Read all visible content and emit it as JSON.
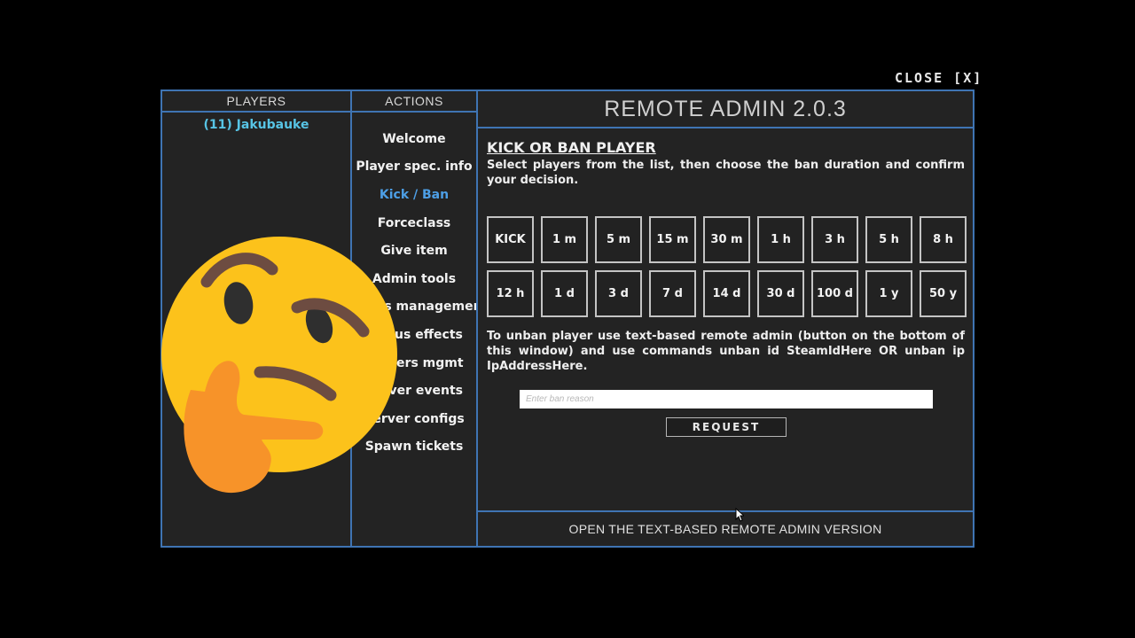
{
  "close_label": "CLOSE [X]",
  "players": {
    "header": "PLAYERS",
    "items": [
      {
        "label": "(11) Jakubauke"
      }
    ]
  },
  "actions": {
    "header": "ACTIONS",
    "items": [
      {
        "label": "Welcome",
        "active": false
      },
      {
        "label": "Player spec. info",
        "active": false
      },
      {
        "label": "Kick / Ban",
        "active": true
      },
      {
        "label": "Forceclass",
        "active": false
      },
      {
        "label": "Give item",
        "active": false
      },
      {
        "label": "Admin tools",
        "active": false
      },
      {
        "label": "Players management",
        "active": false
      },
      {
        "label": "Status effects",
        "active": false
      },
      {
        "label": "Servers mgmt",
        "active": false
      },
      {
        "label": "Server events",
        "active": false
      },
      {
        "label": "Server configs",
        "active": false
      },
      {
        "label": "Spawn tickets",
        "active": false
      }
    ]
  },
  "main": {
    "title": "REMOTE ADMIN 2.0.3",
    "section_title": "KICK OR BAN PLAYER",
    "description": "Select players from the list, then choose the ban duration and confirm your decision.",
    "durations": [
      "KICK",
      "1 m",
      "5 m",
      "15 m",
      "30 m",
      "1 h",
      "3 h",
      "5 h",
      "8 h",
      "12 h",
      "1 d",
      "3 d",
      "7 d",
      "14 d",
      "30 d",
      "100 d",
      "1 y",
      "50 y"
    ],
    "unban_text": "To unban player use text-based remote admin (button on the bottom of this window) and use commands unban id SteamIdHere OR unban ip IpAddressHere.",
    "reason_placeholder": "Enter ban reason",
    "request_label": "REQUEST"
  },
  "footer": {
    "label": "OPEN THE TEXT-BASED REMOTE ADMIN VERSION"
  },
  "overlay": {
    "emoji": "thinking-face-emoji"
  },
  "colors": {
    "panel_border": "#3f74b3",
    "panel_bg": "#232323",
    "player_name": "#57c4e5",
    "active_action": "#4d9fe6",
    "emoji_face": "#fcc21b",
    "emoji_hand": "#f79329"
  }
}
